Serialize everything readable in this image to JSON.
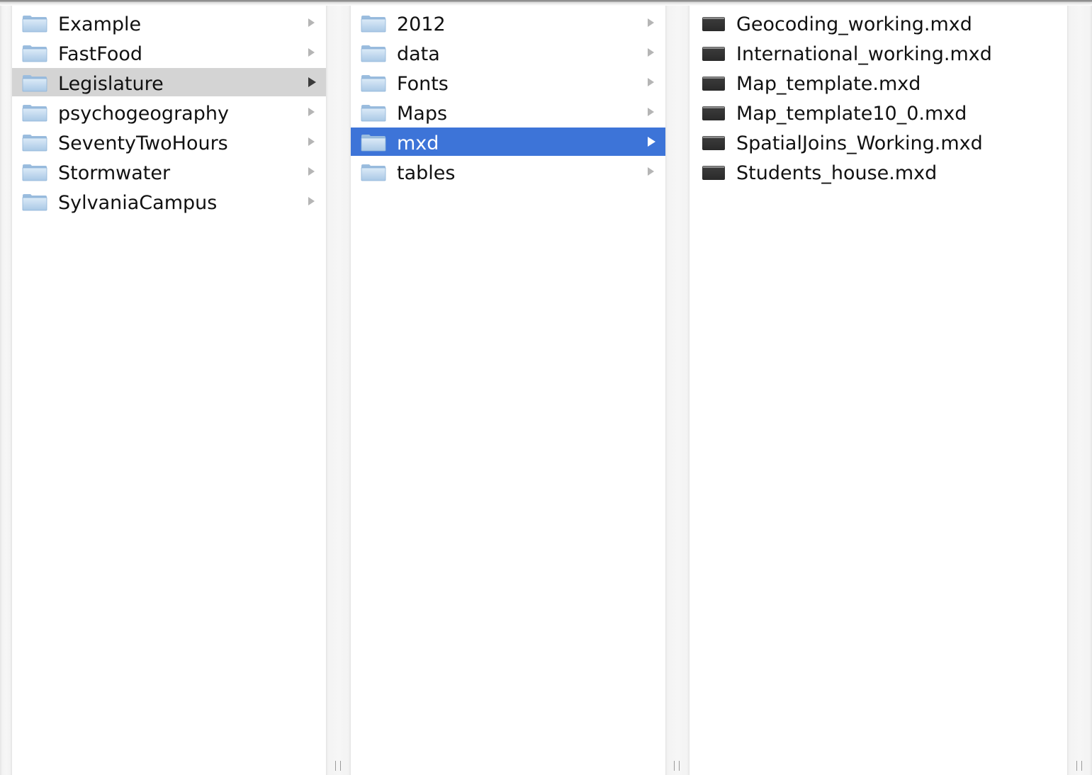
{
  "columns": [
    {
      "items": [
        {
          "label": "Example",
          "icon": "folder-icon",
          "selected": "none"
        },
        {
          "label": "FastFood",
          "icon": "folder-icon",
          "selected": "none"
        },
        {
          "label": "Legislature",
          "icon": "folder-icon",
          "selected": "inactive"
        },
        {
          "label": "psychogeography",
          "icon": "folder-icon",
          "selected": "none"
        },
        {
          "label": "SeventyTwoHours",
          "icon": "folder-icon",
          "selected": "none"
        },
        {
          "label": "Stormwater",
          "icon": "folder-icon",
          "selected": "none"
        },
        {
          "label": "SylvaniaCampus",
          "icon": "folder-icon",
          "selected": "none"
        }
      ]
    },
    {
      "items": [
        {
          "label": "2012",
          "icon": "folder-icon",
          "selected": "none"
        },
        {
          "label": "data",
          "icon": "folder-icon",
          "selected": "none"
        },
        {
          "label": "Fonts",
          "icon": "folder-icon",
          "selected": "none"
        },
        {
          "label": "Maps",
          "icon": "folder-icon",
          "selected": "none"
        },
        {
          "label": "mxd",
          "icon": "folder-icon",
          "selected": "active"
        },
        {
          "label": "tables",
          "icon": "folder-icon",
          "selected": "none"
        }
      ]
    },
    {
      "items": [
        {
          "label": "Geocoding_working.mxd",
          "icon": "mxd-document-icon"
        },
        {
          "label": "International_working.mxd",
          "icon": "mxd-document-icon"
        },
        {
          "label": "Map_template.mxd",
          "icon": "mxd-document-icon"
        },
        {
          "label": "Map_template10_0.mxd",
          "icon": "mxd-document-icon"
        },
        {
          "label": "SpatialJoins_Working.mxd",
          "icon": "mxd-document-icon"
        },
        {
          "label": "Students_house.mxd",
          "icon": "mxd-document-icon"
        }
      ]
    }
  ],
  "colors": {
    "selection_active": "#3d74d8",
    "selection_inactive": "#d4d4d4",
    "folder_light": "#cfe3f5",
    "folder_dark": "#7fa7cc",
    "document_icon": "#3a3a3a"
  }
}
